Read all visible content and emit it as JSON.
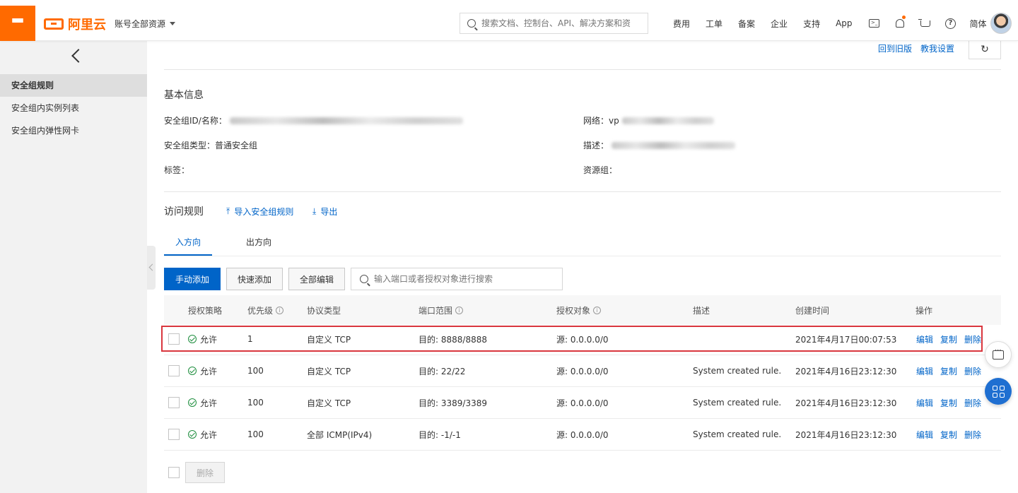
{
  "header": {
    "logo_text": "阿里云",
    "account_label": "账号全部资源",
    "search_placeholder": "搜索文档、控制台、API、解决方案和资",
    "nav": [
      "费用",
      "工单",
      "备案",
      "企业",
      "支持",
      "App"
    ],
    "lang": "简体"
  },
  "sidebar": {
    "items": [
      {
        "label": "安全组规则",
        "active": true
      },
      {
        "label": "安全组内实例列表",
        "active": false
      },
      {
        "label": "安全组内弹性网卡",
        "active": false
      }
    ]
  },
  "page": {
    "links": {
      "old_version": "回到旧版",
      "tutorial": "教我设置"
    },
    "basic_info_title": "基本信息",
    "info": {
      "id_name_label": "安全组ID/名称：",
      "network_label": "网络：",
      "network_prefix": "vp",
      "type_label": "安全组类型：",
      "type_value": "普通安全组",
      "desc_label": "描述：",
      "tags_label": "标签：",
      "resource_group_label": "资源组："
    },
    "access_rules_title": "访问规则",
    "import_label": "导入安全组规则",
    "export_label": "导出",
    "tabs": {
      "inbound": "入方向",
      "outbound": "出方向"
    },
    "buttons": {
      "manual_add": "手动添加",
      "quick_add": "快速添加",
      "edit_all": "全部编辑"
    },
    "filter_placeholder": "输入端口或者授权对象进行搜索",
    "columns": [
      "授权策略",
      "优先级",
      "协议类型",
      "端口范围",
      "授权对象",
      "描述",
      "创建时间",
      "操作"
    ],
    "rows": [
      {
        "policy": "允许",
        "priority": "1",
        "protocol": "自定义 TCP",
        "port": "目的: 8888/8888",
        "source": "源: 0.0.0.0/0",
        "desc": "",
        "time": "2021年4月17日00:07:53"
      },
      {
        "policy": "允许",
        "priority": "100",
        "protocol": "自定义 TCP",
        "port": "目的: 22/22",
        "source": "源: 0.0.0.0/0",
        "desc": "System created rule.",
        "time": "2021年4月16日23:12:30"
      },
      {
        "policy": "允许",
        "priority": "100",
        "protocol": "自定义 TCP",
        "port": "目的: 3389/3389",
        "source": "源: 0.0.0.0/0",
        "desc": "System created rule.",
        "time": "2021年4月16日23:12:30"
      },
      {
        "policy": "允许",
        "priority": "100",
        "protocol": "全部 ICMP(IPv4)",
        "port": "目的: -1/-1",
        "source": "源: 0.0.0.0/0",
        "desc": "System created rule.",
        "time": "2021年4月16日23:12:30"
      }
    ],
    "row_actions": {
      "edit": "编辑",
      "copy": "复制",
      "delete": "删除"
    },
    "bulk_delete": "删除"
  },
  "colors": {
    "brand": "#ff6a00",
    "primary": "#0064c8",
    "highlight": "#d9363e",
    "allow": "#1e8e3e"
  }
}
